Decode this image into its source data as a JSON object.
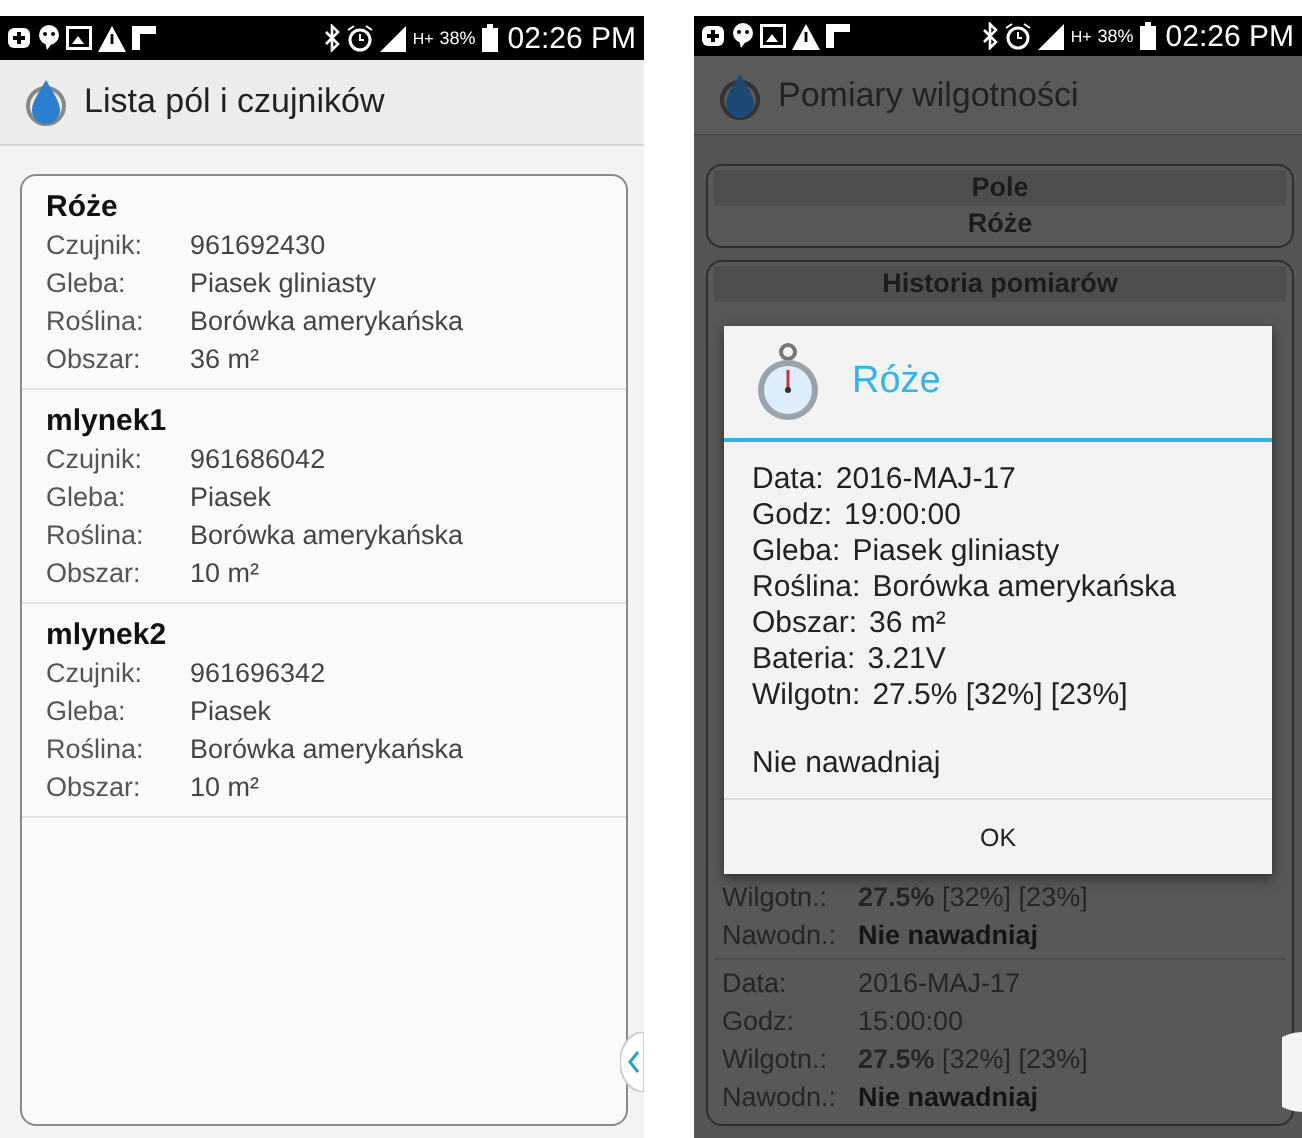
{
  "left_screen": {
    "status_bar": {
      "network": "H+",
      "battery": "38%",
      "time": "02:26 PM"
    },
    "app_bar": {
      "title": "Lista pól i czujników"
    },
    "fields": [
      {
        "name": "Róże",
        "rows": [
          {
            "label": "Czujnik:",
            "value": "961692430"
          },
          {
            "label": "Gleba:",
            "value": "Piasek gliniasty"
          },
          {
            "label": "Roślina:",
            "value": "Borówka amerykańska"
          },
          {
            "label": "Obszar:",
            "value": "36 m²"
          }
        ]
      },
      {
        "name": "mlynek1",
        "rows": [
          {
            "label": "Czujnik:",
            "value": "961686042"
          },
          {
            "label": "Gleba:",
            "value": "Piasek"
          },
          {
            "label": "Roślina:",
            "value": "Borówka amerykańska"
          },
          {
            "label": "Obszar:",
            "value": "10 m²"
          }
        ]
      },
      {
        "name": "mlynek2",
        "rows": [
          {
            "label": "Czujnik:",
            "value": "961696342"
          },
          {
            "label": "Gleba:",
            "value": "Piasek"
          },
          {
            "label": "Roślina:",
            "value": "Borówka amerykańska"
          },
          {
            "label": "Obszar:",
            "value": "10 m²"
          }
        ]
      }
    ]
  },
  "right_screen": {
    "status_bar": {
      "network": "H+",
      "battery": "38%",
      "time": "02:26 PM"
    },
    "app_bar": {
      "title": "Pomiary wilgotności"
    },
    "field_card": {
      "heading": "Pole",
      "value": "Róże"
    },
    "history": {
      "heading": "Historia pomiarów",
      "partial_rows": [
        {
          "label": "Wilgotn.:",
          "value": "**27.5%** [32%] [23%]",
          "bold": false
        },
        {
          "label": "Nawodn.:",
          "value": "Nie nawadniaj",
          "bold": true
        }
      ],
      "records": [
        {
          "rows": [
            {
              "label": "Data:",
              "value": "2016-MAJ-17",
              "bold": false
            },
            {
              "label": "Godz:",
              "value": "15:00:00",
              "bold": false
            },
            {
              "label": "Wilgotn.:",
              "value": "**27.5%** [32%] [23%]",
              "bold": false
            },
            {
              "label": "Nawodn.:",
              "value": "Nie nawadniaj",
              "bold": true
            }
          ]
        }
      ]
    },
    "dialog": {
      "title": "Róże",
      "rows": [
        {
          "label": "Data:",
          "value": "2016-MAJ-17"
        },
        {
          "label": "Godz:",
          "value": "19:00:00"
        },
        {
          "label": "Gleba:",
          "value": "Piasek gliniasty"
        },
        {
          "label": "Roślina:",
          "value": "Borówka amerykańska"
        },
        {
          "label": "Obszar:",
          "value": "36 m²"
        },
        {
          "label": "Bateria:",
          "value": "3.21V"
        },
        {
          "label": "Wilgotn:",
          "value": "27.5% [32%] [23%]"
        }
      ],
      "message": "Nie nawadniaj",
      "button": "OK"
    }
  }
}
